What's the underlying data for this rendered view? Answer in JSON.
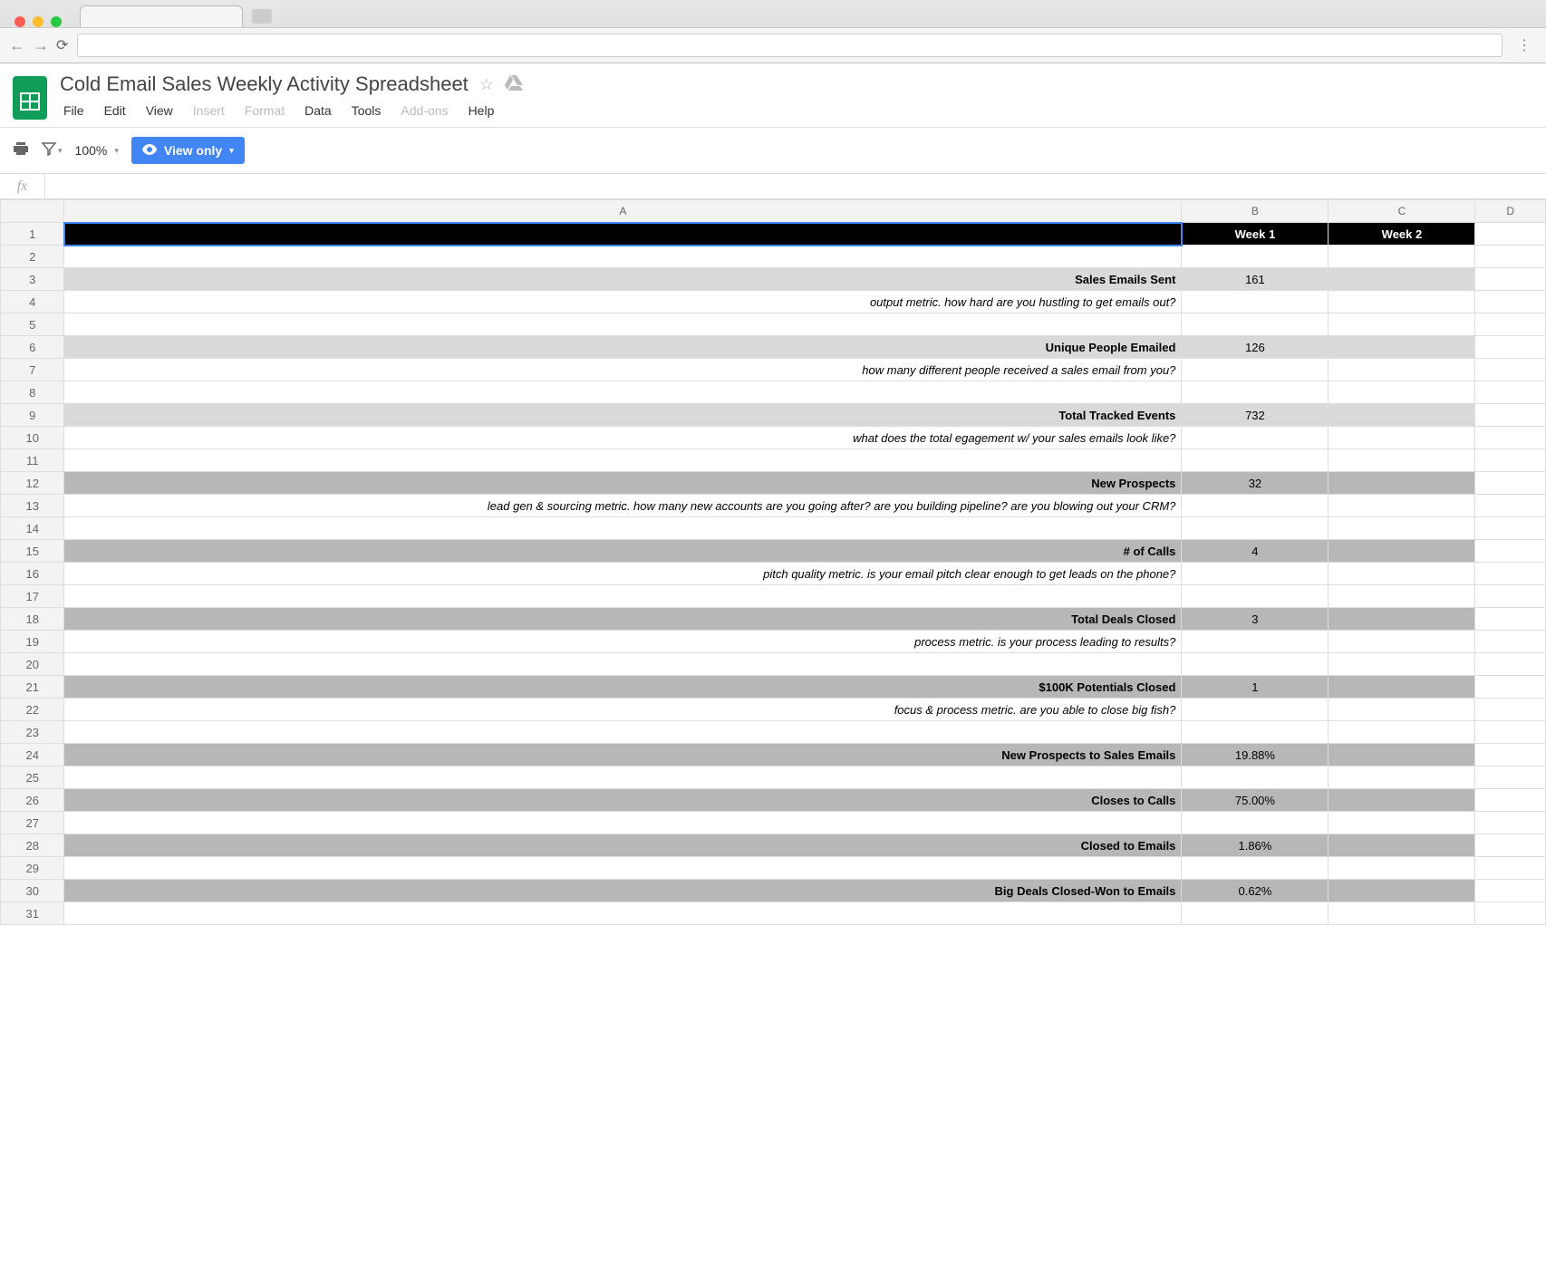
{
  "browser": {
    "url_placeholder": ""
  },
  "doc": {
    "title": "Cold Email Sales Weekly Activity Spreadsheet"
  },
  "menubar": {
    "file": "File",
    "edit": "Edit",
    "view": "View",
    "insert": "Insert",
    "format": "Format",
    "data": "Data",
    "tools": "Tools",
    "addons": "Add-ons",
    "help": "Help"
  },
  "toolbar": {
    "zoom": "100%",
    "view_only": "View only"
  },
  "formula": {
    "fx": "fx",
    "value": ""
  },
  "columns": {
    "a": "A",
    "b": "B",
    "c": "C",
    "d": "D"
  },
  "headers": {
    "week1": "Week 1",
    "week2": "Week 2"
  },
  "rows": [
    {
      "type": "metric",
      "label": "Sales Emails Sent",
      "b": "161",
      "shade": "light"
    },
    {
      "type": "desc",
      "text": "output metric. how hard are you hustling to get emails out?"
    },
    {
      "type": "blank"
    },
    {
      "type": "metric",
      "label": "Unique People Emailed",
      "b": "126",
      "shade": "light"
    },
    {
      "type": "desc",
      "text": "how many different people received a sales email from you?"
    },
    {
      "type": "blank"
    },
    {
      "type": "metric",
      "label": "Total Tracked Events",
      "b": "732",
      "shade": "light"
    },
    {
      "type": "desc",
      "text": "what does the total egagement w/ your sales emails look like?"
    },
    {
      "type": "blank"
    },
    {
      "type": "metric",
      "label": "New Prospects",
      "b": "32",
      "shade": "dark"
    },
    {
      "type": "desc",
      "text": "lead gen & sourcing metric. how many new accounts are you going after? are you building pipeline? are you blowing out your CRM?"
    },
    {
      "type": "blank"
    },
    {
      "type": "metric",
      "label": "# of Calls",
      "b": "4",
      "shade": "dark"
    },
    {
      "type": "desc",
      "text": "pitch quality metric. is your email pitch clear enough to get leads on the phone?"
    },
    {
      "type": "blank"
    },
    {
      "type": "metric",
      "label": "Total Deals Closed",
      "b": "3",
      "shade": "dark"
    },
    {
      "type": "desc",
      "text": "process metric. is your process leading to results?"
    },
    {
      "type": "blank"
    },
    {
      "type": "metric",
      "label": "$100K Potentials Closed",
      "b": "1",
      "shade": "dark"
    },
    {
      "type": "desc",
      "text": "focus & process metric. are you able to close big fish?"
    },
    {
      "type": "blank"
    },
    {
      "type": "metric",
      "label": "New Prospects to Sales Emails",
      "b": "19.88%",
      "shade": "dark"
    },
    {
      "type": "blank"
    },
    {
      "type": "metric",
      "label": "Closes to Calls",
      "b": "75.00%",
      "shade": "dark"
    },
    {
      "type": "blank"
    },
    {
      "type": "metric",
      "label": "Closed to Emails",
      "b": "1.86%",
      "shade": "dark"
    },
    {
      "type": "blank"
    },
    {
      "type": "metric",
      "label": "Big Deals Closed-Won to Emails",
      "b": "0.62%",
      "shade": "dark"
    },
    {
      "type": "blank"
    }
  ]
}
